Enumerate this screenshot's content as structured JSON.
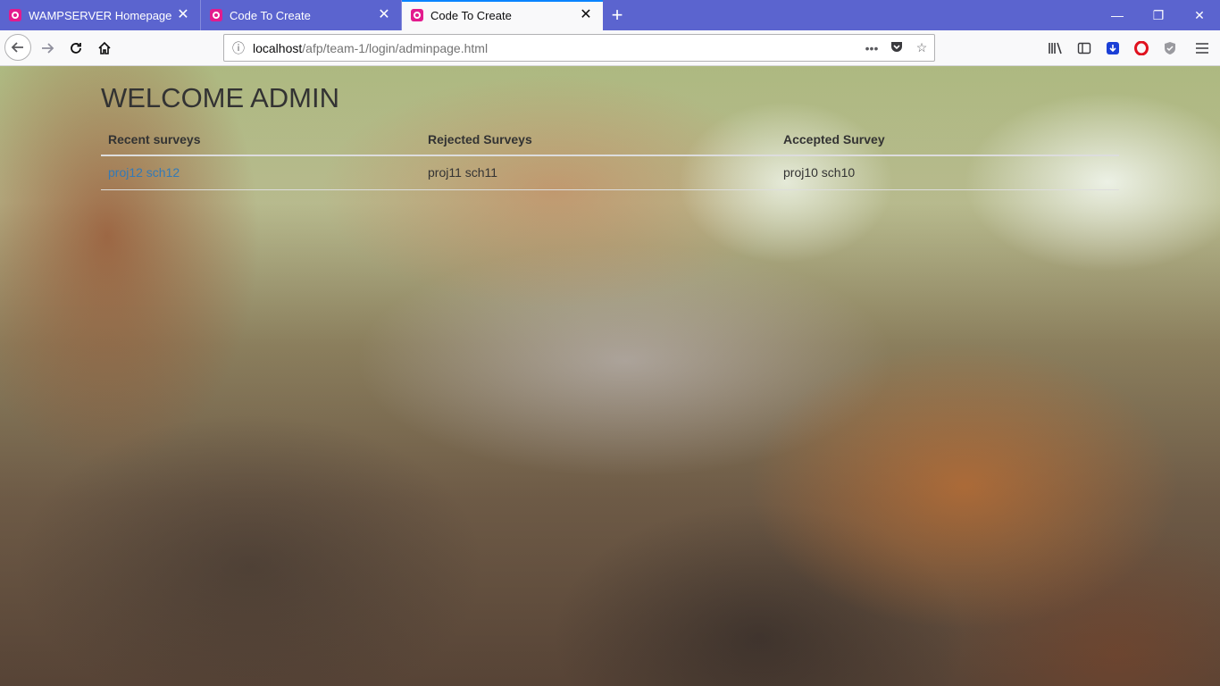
{
  "browser": {
    "tabs": [
      {
        "title": "WAMPSERVER Homepage",
        "active": false
      },
      {
        "title": "Code To Create",
        "active": false
      },
      {
        "title": "Code To Create",
        "active": true
      }
    ],
    "new_tab": "+",
    "window_controls": {
      "minimize": "—",
      "restore": "❐",
      "close": "✕"
    },
    "url": {
      "host": "localhost",
      "path": "/afp/team-1/login/adminpage.html"
    },
    "accent_color": "#5b64cf"
  },
  "page": {
    "title": "WELCOME ADMIN",
    "table": {
      "headers": [
        "Recent surveys",
        "Rejected Surveys",
        "Accepted Survey"
      ],
      "rows": [
        [
          "proj12 sch12",
          "proj11 sch11",
          "proj10 sch10"
        ]
      ]
    }
  }
}
